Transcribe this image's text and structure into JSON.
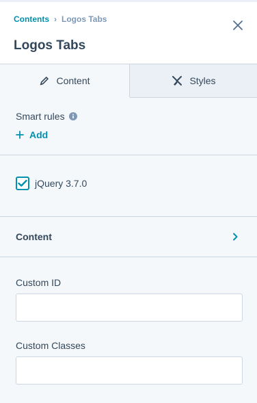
{
  "header": {
    "breadcrumb_parent": "Contents",
    "breadcrumb_separator": "›",
    "breadcrumb_current": "Logos Tabs",
    "title": "Logos Tabs",
    "close_icon": "close-icon"
  },
  "tabs": [
    {
      "label": "Content",
      "icon": "pencil-icon",
      "selected": true
    },
    {
      "label": "Styles",
      "icon": "brush-icon",
      "selected": false
    }
  ],
  "smart_rules": {
    "label": "Smart rules",
    "info_icon": "info-icon",
    "add_label": "Add"
  },
  "library": {
    "label": "jQuery 3.7.0",
    "checked": true
  },
  "content_section": {
    "label": "Content",
    "icon": "chevron-right-icon"
  },
  "fields": {
    "custom_id": {
      "label": "Custom ID",
      "value": ""
    },
    "custom_classes": {
      "label": "Custom Classes",
      "value": ""
    }
  },
  "colors": {
    "accent": "#0091ae",
    "text": "#33475b",
    "muted": "#7c98b6",
    "border": "#cbd6e2",
    "panel_bg": "#f5f8fa",
    "inactive_tab_bg": "#eaf0f6"
  }
}
